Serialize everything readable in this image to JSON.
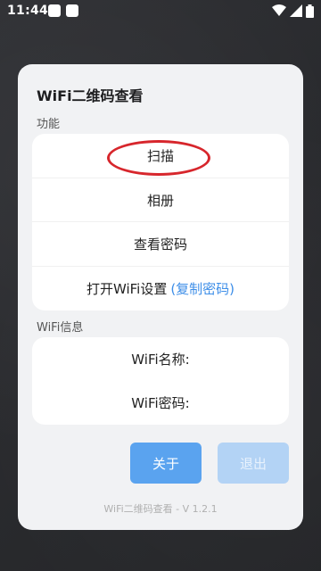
{
  "status_bar": {
    "time": "11:44"
  },
  "dialog": {
    "title": "WiFi二维码查看",
    "function_section_label": "功能",
    "functions": [
      {
        "label": "扫描"
      },
      {
        "label": "相册"
      },
      {
        "label": "查看密码"
      },
      {
        "label": "打开WiFi设置",
        "link": "(复制密码)"
      }
    ],
    "info_section_label": "WiFi信息",
    "info": {
      "name_label": "WiFi名称:",
      "password_label": "WiFi密码:"
    },
    "buttons": {
      "about": "关于",
      "exit": "退出"
    },
    "version": "WiFi二维码查看 - V 1.2.1"
  },
  "colors": {
    "accent": "#5aa3ef",
    "accent_disabled": "#b3d3f5",
    "highlight": "#d7262c",
    "link": "#3d8ee8"
  }
}
